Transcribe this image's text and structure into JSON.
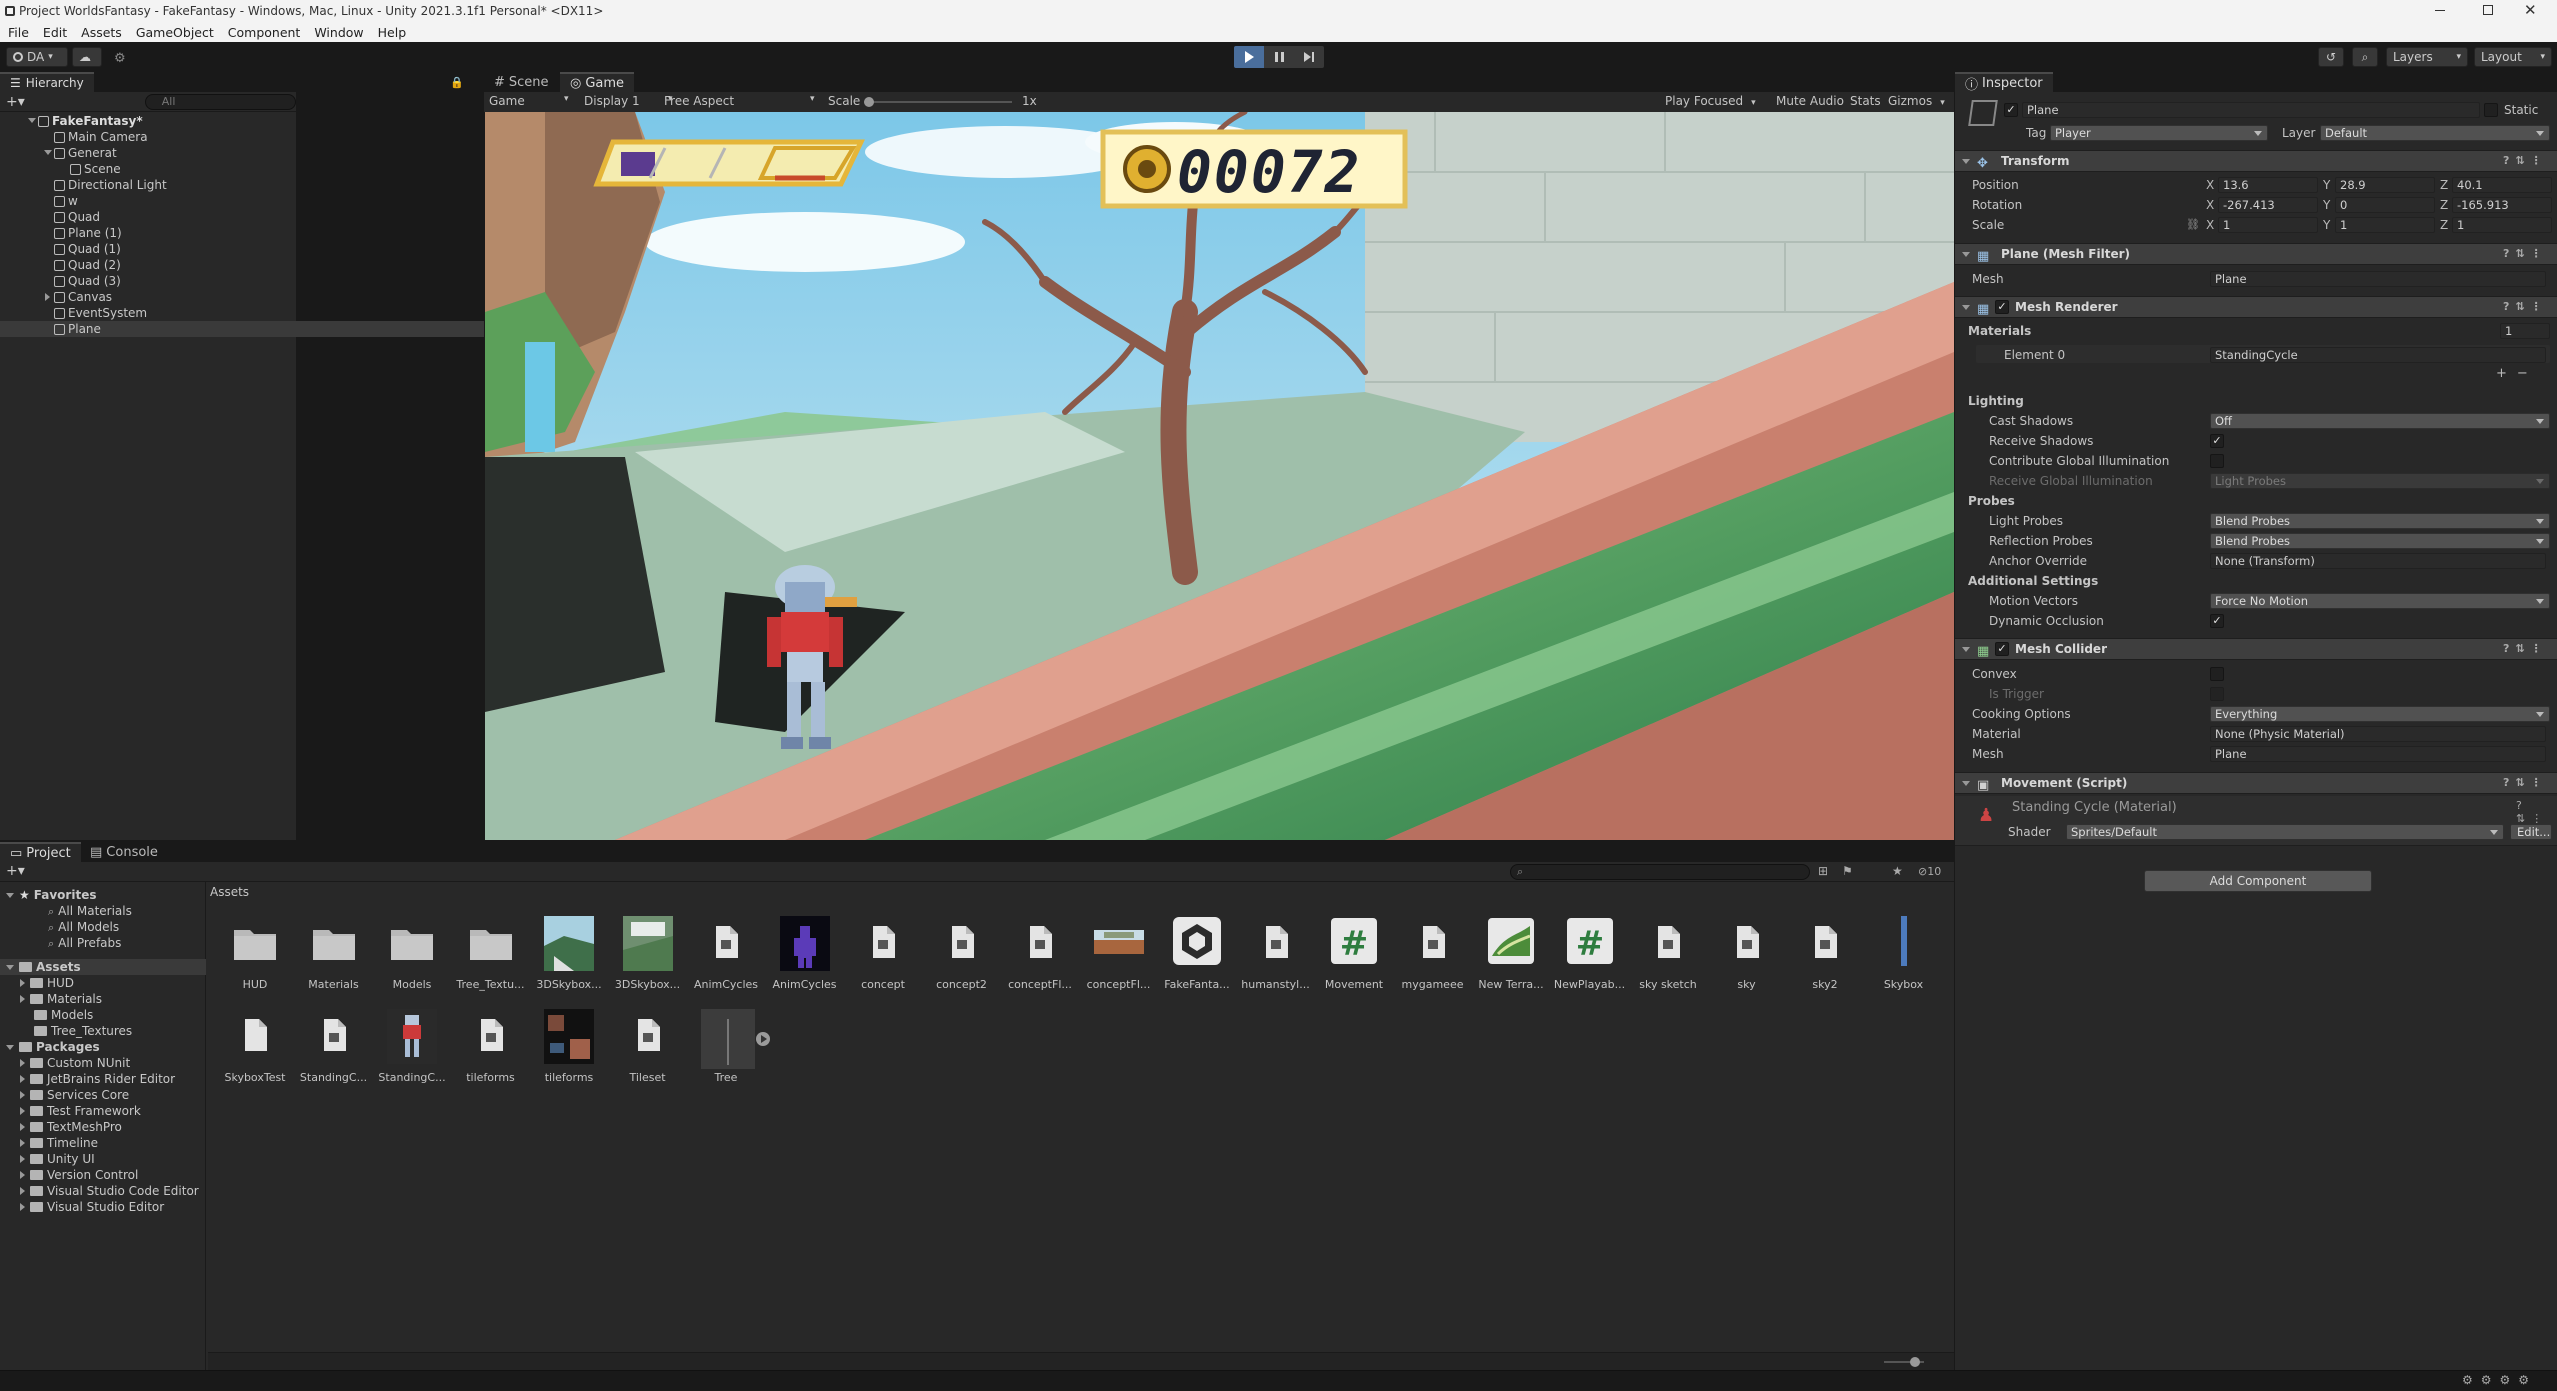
{
  "window": {
    "title": "Project WorldsFantasy - FakeFantasy - Windows, Mac, Linux - Unity 2021.3.1f1 Personal* <DX11>"
  },
  "menu": [
    "File",
    "Edit",
    "Assets",
    "GameObject",
    "Component",
    "Window",
    "Help"
  ],
  "toolbar": {
    "account": "DA",
    "layers": "Layers",
    "layout": "Layout"
  },
  "hierarchy": {
    "tab": "Hierarchy",
    "search_placeholder": "All",
    "items": [
      {
        "label": "FakeFantasy*"
      },
      {
        "label": "Main Camera"
      },
      {
        "label": "Generat"
      },
      {
        "label": "Scene"
      },
      {
        "label": "Directional Light"
      },
      {
        "label": "w"
      },
      {
        "label": "Quad"
      },
      {
        "label": "Plane (1)"
      },
      {
        "label": "Quad (1)"
      },
      {
        "label": "Quad (2)"
      },
      {
        "label": "Quad (3)"
      },
      {
        "label": "Canvas"
      },
      {
        "label": "EventSystem"
      },
      {
        "label": "Plane"
      }
    ]
  },
  "game_view": {
    "tabs": [
      {
        "label": "Scene"
      },
      {
        "label": "Game"
      }
    ],
    "mode": "Game",
    "display": "Display 1",
    "aspect": "Free Aspect",
    "scale_label": "Scale",
    "scale_value": "1x",
    "play_focused": "Play Focused",
    "mute": "Mute Audio",
    "stats": "Stats",
    "gizmos": "Gizmos",
    "coin_counter": "00072"
  },
  "inspector": {
    "tab": "Inspector",
    "object_name": "Plane",
    "static_label": "Static",
    "tag_label": "Tag",
    "tag_value": "Player",
    "layer_label": "Layer",
    "layer_value": "Default",
    "transform": {
      "title": "Transform",
      "position": {
        "label": "Position",
        "x": "13.6",
        "y": "28.9",
        "z": "40.1"
      },
      "rotation": {
        "label": "Rotation",
        "x": "-267.413",
        "y": "0",
        "z": "-165.913"
      },
      "scale": {
        "label": "Scale",
        "x": "1",
        "y": "1",
        "z": "1"
      }
    },
    "axis": {
      "x": "X",
      "y": "Y",
      "z": "Z"
    },
    "mesh_filter": {
      "title": "Plane (Mesh Filter)",
      "mesh_label": "Mesh",
      "mesh_value": "Plane"
    },
    "mesh_renderer": {
      "title": "Mesh Renderer",
      "materials_label": "Materials",
      "materials_count": "1",
      "element0_label": "Element 0",
      "element0_value": "StandingCycle",
      "lighting_label": "Lighting",
      "cast_shadows_label": "Cast Shadows",
      "cast_shadows_value": "Off",
      "receive_shadows_label": "Receive Shadows",
      "contribute_gi_label": "Contribute Global Illumination",
      "receive_gi_label": "Receive Global Illumination",
      "receive_gi_value": "Light Probes",
      "probes_label": "Probes",
      "light_probes_label": "Light Probes",
      "light_probes_value": "Blend Probes",
      "reflection_probes_label": "Reflection Probes",
      "reflection_probes_value": "Blend Probes",
      "anchor_label": "Anchor Override",
      "anchor_value": "None (Transform)",
      "additional_label": "Additional Settings",
      "motion_vectors_label": "Motion Vectors",
      "motion_vectors_value": "Force No Motion",
      "dynamic_occlusion_label": "Dynamic Occlusion"
    },
    "mesh_collider": {
      "title": "Mesh Collider",
      "convex_label": "Convex",
      "trigger_label": "Is Trigger",
      "cooking_label": "Cooking Options",
      "cooking_value": "Everything",
      "material_label": "Material",
      "material_value": "None (Physic Material)",
      "mesh_label": "Mesh",
      "mesh_value": "Plane"
    },
    "movement": {
      "title": "Movement (Script)"
    },
    "material": {
      "title": "Standing Cycle (Material)",
      "shader_label": "Shader",
      "shader_value": "Sprites/Default",
      "edit_label": "Edit..."
    },
    "add_component": "Add Component"
  },
  "project": {
    "tabs": [
      {
        "label": "Project"
      },
      {
        "label": "Console"
      }
    ],
    "badge": "10",
    "breadcrumb": "Assets",
    "favorites": {
      "label": "Favorites",
      "items": [
        "All Materials",
        "All Models",
        "All Prefabs"
      ]
    },
    "assets_tree": {
      "label": "Assets",
      "items": [
        "HUD",
        "Materials",
        "Models",
        "Tree_Textures"
      ]
    },
    "packages": {
      "label": "Packages",
      "items": [
        "Custom NUnit",
        "JetBrains Rider Editor",
        "Services Core",
        "Test Framework",
        "TextMeshPro",
        "Timeline",
        "Unity UI",
        "Version Control",
        "Visual Studio Code Editor",
        "Visual Studio Editor"
      ]
    },
    "assets": [
      {
        "label": "HUD",
        "type": "folder"
      },
      {
        "label": "Materials",
        "type": "folder"
      },
      {
        "label": "Models",
        "type": "folder"
      },
      {
        "label": "Tree_Textu...",
        "type": "folder"
      },
      {
        "label": "3DSkybox...",
        "type": "img-sky"
      },
      {
        "label": "3DSkybox...",
        "type": "img-sky2"
      },
      {
        "label": "AnimCycles",
        "type": "file"
      },
      {
        "label": "AnimCycles",
        "type": "img-purple"
      },
      {
        "label": "concept",
        "type": "file"
      },
      {
        "label": "concept2",
        "type": "file"
      },
      {
        "label": "conceptFl...",
        "type": "file"
      },
      {
        "label": "conceptFl...",
        "type": "img-concept"
      },
      {
        "label": "FakeFanta...",
        "type": "unity"
      },
      {
        "label": "humanstyl...",
        "type": "file"
      },
      {
        "label": "Movement",
        "type": "script"
      },
      {
        "label": "mygameee",
        "type": "file"
      },
      {
        "label": "New Terra...",
        "type": "terrain"
      },
      {
        "label": "NewPlayab...",
        "type": "script"
      },
      {
        "label": "sky sketch",
        "type": "file"
      },
      {
        "label": "sky",
        "type": "file"
      },
      {
        "label": "sky2",
        "type": "file"
      },
      {
        "label": "Skybox",
        "type": "skybox"
      },
      {
        "label": "SkyboxTest",
        "type": "doc"
      },
      {
        "label": "StandingC...",
        "type": "file"
      },
      {
        "label": "StandingC...",
        "type": "img-robot"
      },
      {
        "label": "tileforms",
        "type": "file"
      },
      {
        "label": "tileforms",
        "type": "img-tile"
      },
      {
        "label": "Tileset",
        "type": "file"
      },
      {
        "label": "Tree",
        "type": "tree"
      }
    ]
  },
  "colors": {
    "accent": "#3a79bb",
    "panel": "#282828",
    "bg": "#191919",
    "header": "#3e3e3e"
  }
}
